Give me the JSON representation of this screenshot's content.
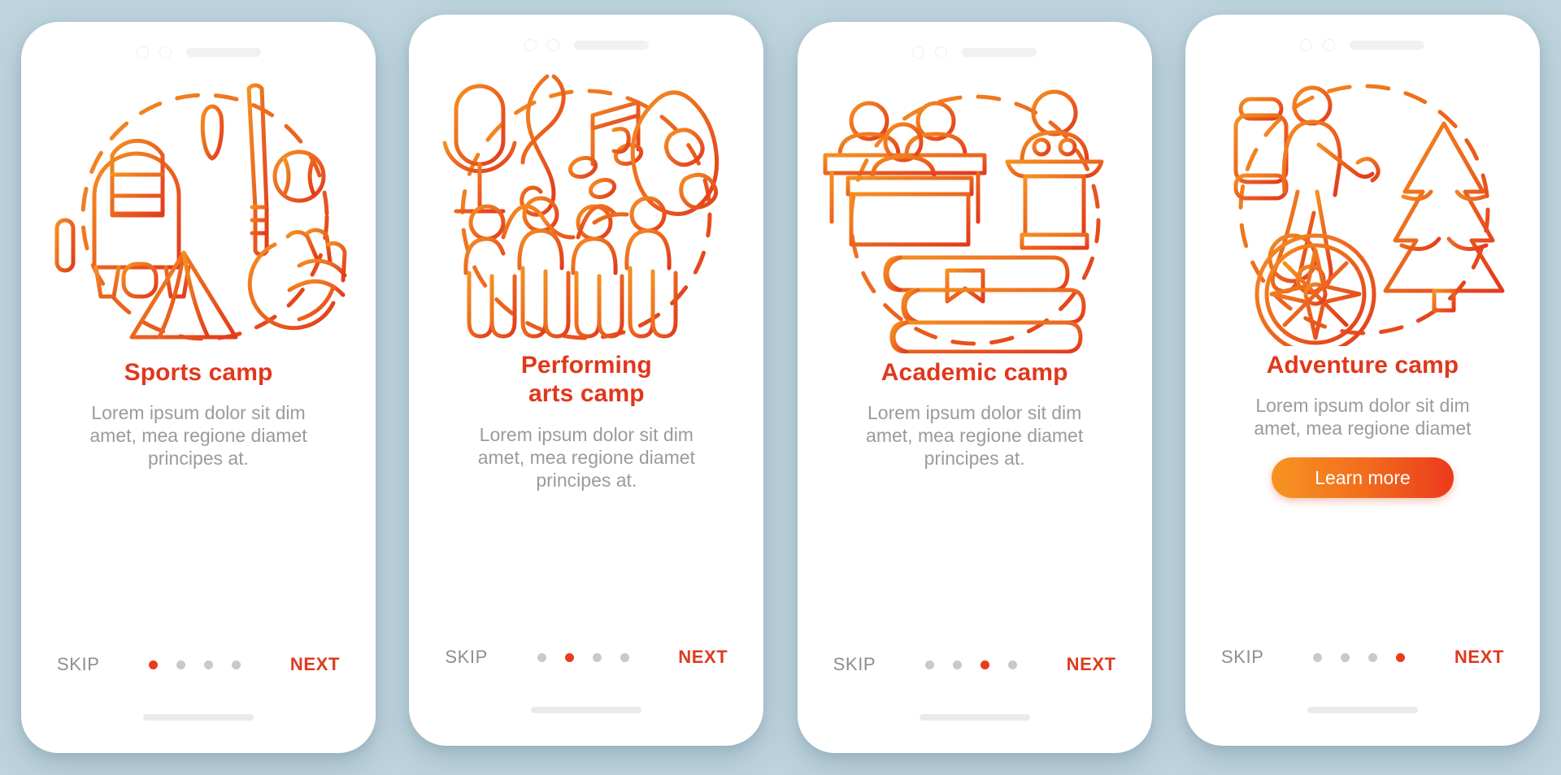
{
  "background_color": "#bdd3dd",
  "accent_color": "#ec3a1d",
  "title_color": "#e0381c",
  "muted_color": "#9b9b9b",
  "cta_gradient": [
    "#f79421",
    "#ec3a1d"
  ],
  "common": {
    "skip_label": "SKIP",
    "next_label": "NEXT",
    "description": "Lorem ipsum dolor sit dim\namet, mea regione diamet\nprincipes at.",
    "dot_count": 4
  },
  "screens": [
    {
      "id": "sports-camp",
      "title": "Sports camp",
      "description": "Lorem ipsum dolor sit dim\namet, mea regione diamet\nprincipes at.",
      "skip_label": "SKIP",
      "next_label": "NEXT",
      "active_dot": 1,
      "cta_label": null,
      "illustration": "sports-equipment-illustration",
      "icons": [
        "paddle-icon",
        "raft-icon",
        "oar-icon",
        "baseball-bat-icon",
        "baseball-icon",
        "baseball-glove-icon",
        "tent-icon",
        "dashed-circle-icon"
      ]
    },
    {
      "id": "performing-arts-camp",
      "title": "Performing\narts camp",
      "description": "Lorem ipsum dolor sit dim\namet, mea regione diamet\nprincipes at.",
      "skip_label": "SKIP",
      "next_label": "NEXT",
      "active_dot": 2,
      "cta_label": null,
      "illustration": "performing-arts-illustration",
      "icons": [
        "microphone-icon",
        "treble-clef-icon",
        "music-note-icon",
        "theater-mask-icon",
        "dancers-icon",
        "dashed-circle-icon"
      ]
    },
    {
      "id": "academic-camp",
      "title": "Academic camp",
      "description": "Lorem ipsum dolor sit dim\namet, mea regione diamet\nprincipes at.",
      "skip_label": "SKIP",
      "next_label": "NEXT",
      "active_dot": 3,
      "cta_label": null,
      "illustration": "academic-illustration",
      "icons": [
        "students-desk-icon",
        "teacher-podium-icon",
        "book-stack-icon",
        "bookmark-icon",
        "dashed-circle-icon"
      ]
    },
    {
      "id": "adventure-camp",
      "title": "Adventure camp",
      "description": "Lorem ipsum dolor sit dim\namet, mea regione diamet",
      "skip_label": "SKIP",
      "next_label": "NEXT",
      "active_dot": 4,
      "cta_label": "Learn more",
      "illustration": "adventure-illustration",
      "icons": [
        "hiker-backpack-icon",
        "pine-tree-icon",
        "compass-icon",
        "dashed-circle-icon"
      ]
    }
  ]
}
